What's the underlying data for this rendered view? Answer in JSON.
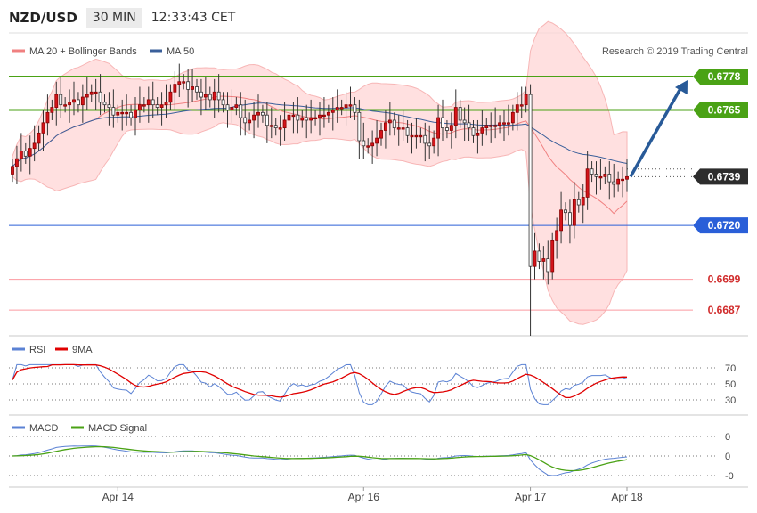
{
  "header": {
    "symbol": "NZD/USD",
    "timeframe": "30 MIN",
    "time": "12:33:43 CET"
  },
  "legend": {
    "bollinger": "MA 20 + Bollinger Bands",
    "ma50": "MA 50",
    "credit": "Research © 2019 Trading Central"
  },
  "colors": {
    "up": "#d4141a",
    "down": "#d4141a",
    "resistance": "#4aa215",
    "support": "#2a5fd8",
    "target": "#fb9aa0",
    "ma20": "#f08080",
    "ma50": "#3a5f9a",
    "band": "#ffd6d6",
    "arrow": "#285a98",
    "rsi": "#5b82d4",
    "rsi_ma": "#e00000",
    "macd": "#5b82d4",
    "macd_signal": "#4aa215"
  },
  "chart_data": [
    {
      "type": "candlestick",
      "title": "NZD/USD",
      "ylim": [
        0.6677,
        0.6795
      ],
      "x_labels": [
        "Apr 14",
        "Apr 16",
        "Apr 17",
        "Apr 18"
      ],
      "levels": [
        {
          "value": 0.6778,
          "label": "0.6778",
          "kind": "resistance"
        },
        {
          "value": 0.6765,
          "label": "0.6765",
          "kind": "resistance"
        },
        {
          "value": 0.6739,
          "label": "0.6739",
          "kind": "current"
        },
        {
          "value": 0.672,
          "label": "0.6720",
          "kind": "support"
        },
        {
          "value": 0.6699,
          "label": "0.6699",
          "kind": "target"
        },
        {
          "value": 0.6687,
          "label": "0.6687",
          "kind": "target"
        }
      ],
      "close": [
        0.6743,
        0.6746,
        0.6749,
        0.6747,
        0.675,
        0.6752,
        0.6756,
        0.676,
        0.6764,
        0.6766,
        0.6771,
        0.6767,
        0.6767,
        0.6768,
        0.6769,
        0.6767,
        0.677,
        0.6771,
        0.6772,
        0.6772,
        0.6768,
        0.6767,
        0.6766,
        0.6763,
        0.6764,
        0.6764,
        0.6764,
        0.6762,
        0.6765,
        0.6767,
        0.6767,
        0.6769,
        0.6767,
        0.6766,
        0.6767,
        0.6768,
        0.6772,
        0.6775,
        0.6776,
        0.6776,
        0.6773,
        0.6774,
        0.6772,
        0.677,
        0.6771,
        0.6769,
        0.6772,
        0.6769,
        0.6767,
        0.6765,
        0.6766,
        0.6767,
        0.6762,
        0.676,
        0.6761,
        0.6763,
        0.6764,
        0.6763,
        0.6759,
        0.6759,
        0.6758,
        0.6758,
        0.6761,
        0.6763,
        0.6763,
        0.6761,
        0.6762,
        0.6761,
        0.6762,
        0.6762,
        0.6763,
        0.6763,
        0.6764,
        0.6765,
        0.6766,
        0.6766,
        0.6767,
        0.6767,
        0.6764,
        0.6753,
        0.6751,
        0.6751,
        0.6752,
        0.6754,
        0.6757,
        0.676,
        0.6761,
        0.6758,
        0.6758,
        0.6758,
        0.6755,
        0.6755,
        0.6755,
        0.6755,
        0.6752,
        0.6751,
        0.6754,
        0.6762,
        0.6758,
        0.6757,
        0.6759,
        0.6766,
        0.6761,
        0.676,
        0.6758,
        0.6755,
        0.6756,
        0.6758,
        0.6759,
        0.6759,
        0.6759,
        0.676,
        0.676,
        0.676,
        0.6764,
        0.6767,
        0.6767,
        0.6771,
        0.6704,
        0.671,
        0.6706,
        0.6707,
        0.6702,
        0.6714,
        0.6718,
        0.6726,
        0.6725,
        0.672,
        0.673,
        0.6728,
        0.6731,
        0.6742,
        0.674,
        0.6739,
        0.6739,
        0.674,
        0.6737,
        0.6736,
        0.6738,
        0.6738,
        0.6739
      ],
      "rsi": {
        "name": "RSI",
        "ma_name": "9MA",
        "ticks": [
          70,
          50,
          30
        ]
      },
      "macd": {
        "name": "MACD",
        "signal_name": "MACD Signal",
        "ticks": [
          "0",
          "0",
          "-0"
        ]
      }
    }
  ]
}
